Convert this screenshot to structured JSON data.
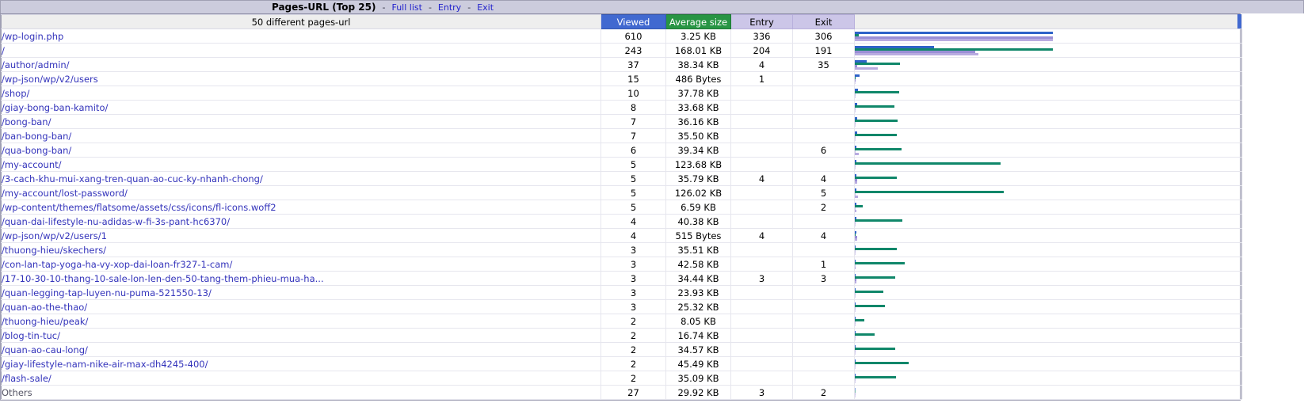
{
  "header": {
    "title": "Pages-URL (Top 25)",
    "separator": "-",
    "links": [
      {
        "label": "Full list"
      },
      {
        "label": "Entry"
      },
      {
        "label": "Exit"
      }
    ]
  },
  "table": {
    "summary_label": "50 different pages-url",
    "columns": {
      "url": "",
      "viewed": "Viewed",
      "average_size": "Average size",
      "entry": "Entry",
      "exit": "Exit"
    },
    "colors": {
      "viewed": "#4169d0",
      "average_size": "#289544",
      "entry": "#ccc6e8",
      "exit": "#ccc6e8",
      "bar_viewed": "#2e63c8",
      "bar_size": "#10876a",
      "bar_entry": "#9a8fd6",
      "bar_exit": "#b8abe0"
    },
    "rows": [
      {
        "url": "/wp-login.php",
        "viewed": "610",
        "average_size": "3.25 KB",
        "entry": "336",
        "exit": "306"
      },
      {
        "url": "/",
        "viewed": "243",
        "average_size": "168.01 KB",
        "entry": "204",
        "exit": "191"
      },
      {
        "url": "/author/admin/",
        "viewed": "37",
        "average_size": "38.34 KB",
        "entry": "4",
        "exit": "35"
      },
      {
        "url": "/wp-json/wp/v2/users",
        "viewed": "15",
        "average_size": "486 Bytes",
        "entry": "1",
        "exit": ""
      },
      {
        "url": "/shop/",
        "viewed": "10",
        "average_size": "37.78 KB",
        "entry": "",
        "exit": ""
      },
      {
        "url": "/giay-bong-ban-kamito/",
        "viewed": "8",
        "average_size": "33.68 KB",
        "entry": "",
        "exit": ""
      },
      {
        "url": "/bong-ban/",
        "viewed": "7",
        "average_size": "36.16 KB",
        "entry": "",
        "exit": ""
      },
      {
        "url": "/ban-bong-ban/",
        "viewed": "7",
        "average_size": "35.50 KB",
        "entry": "",
        "exit": ""
      },
      {
        "url": "/qua-bong-ban/",
        "viewed": "6",
        "average_size": "39.34 KB",
        "entry": "",
        "exit": "6"
      },
      {
        "url": "/my-account/",
        "viewed": "5",
        "average_size": "123.68 KB",
        "entry": "",
        "exit": ""
      },
      {
        "url": "/3-cach-khu-mui-xang-tren-quan-ao-cuc-ky-nhanh-chong/",
        "viewed": "5",
        "average_size": "35.79 KB",
        "entry": "4",
        "exit": "4"
      },
      {
        "url": "/my-account/lost-password/",
        "viewed": "5",
        "average_size": "126.02 KB",
        "entry": "",
        "exit": "5"
      },
      {
        "url": "/wp-content/themes/flatsome/assets/css/icons/fl-icons.woff2",
        "viewed": "5",
        "average_size": "6.59 KB",
        "entry": "",
        "exit": "2"
      },
      {
        "url": "/quan-dai-lifestyle-nu-adidas-w-fi-3s-pant-hc6370/",
        "viewed": "4",
        "average_size": "40.38 KB",
        "entry": "",
        "exit": ""
      },
      {
        "url": "/wp-json/wp/v2/users/1",
        "viewed": "4",
        "average_size": "515 Bytes",
        "entry": "4",
        "exit": "4"
      },
      {
        "url": "/thuong-hieu/skechers/",
        "viewed": "3",
        "average_size": "35.51 KB",
        "entry": "",
        "exit": ""
      },
      {
        "url": "/con-lan-tap-yoga-ha-vy-xop-dai-loan-fr327-1-cam/",
        "viewed": "3",
        "average_size": "42.58 KB",
        "entry": "",
        "exit": "1"
      },
      {
        "url": "/17-10-30-10-thang-10-sale-lon-len-den-50-tang-them-phieu-mua-ha...",
        "viewed": "3",
        "average_size": "34.44 KB",
        "entry": "3",
        "exit": "3"
      },
      {
        "url": "/quan-legging-tap-luyen-nu-puma-521550-13/",
        "viewed": "3",
        "average_size": "23.93 KB",
        "entry": "",
        "exit": ""
      },
      {
        "url": "/quan-ao-the-thao/",
        "viewed": "3",
        "average_size": "25.32 KB",
        "entry": "",
        "exit": ""
      },
      {
        "url": "/thuong-hieu/peak/",
        "viewed": "2",
        "average_size": "8.05 KB",
        "entry": "",
        "exit": ""
      },
      {
        "url": "/blog-tin-tuc/",
        "viewed": "2",
        "average_size": "16.74 KB",
        "entry": "",
        "exit": ""
      },
      {
        "url": "/quan-ao-cau-long/",
        "viewed": "2",
        "average_size": "34.57 KB",
        "entry": "",
        "exit": ""
      },
      {
        "url": "/giay-lifestyle-nam-nike-air-max-dh4245-400/",
        "viewed": "2",
        "average_size": "45.49 KB",
        "entry": "",
        "exit": ""
      },
      {
        "url": "/flash-sale/",
        "viewed": "2",
        "average_size": "35.09 KB",
        "entry": "",
        "exit": ""
      },
      {
        "url": "Others",
        "viewed": "27",
        "average_size": "29.92 KB",
        "entry": "3",
        "exit": "2"
      }
    ]
  },
  "chart_data": {
    "type": "bar",
    "title": "Pages-URL (Top 25)",
    "orientation": "horizontal",
    "grid": false,
    "legend": [
      "Viewed",
      "Average size",
      "Entry",
      "Exit"
    ],
    "legend_position": "column-headers",
    "categories": [
      "/wp-login.php",
      "/",
      "/author/admin/",
      "/wp-json/wp/v2/users",
      "/shop/",
      "/giay-bong-ban-kamito/",
      "/bong-ban/",
      "/ban-bong-ban/",
      "/qua-bong-ban/",
      "/my-account/",
      "/3-cach-khu-mui-xang-tren-quan-ao-cuc-ky-nhanh-chong/",
      "/my-account/lost-password/",
      "/wp-content/themes/flatsome/assets/css/icons/fl-icons.woff2",
      "/quan-dai-lifestyle-nu-adidas-w-fi-3s-pant-hc6370/",
      "/wp-json/wp/v2/users/1",
      "/thuong-hieu/skechers/",
      "/con-lan-tap-yoga-ha-vy-xop-dai-loan-fr327-1-cam/",
      "/17-10-30-10-thang-10-sale-lon-len-den-50-tang-them-phieu-mua-ha...",
      "/quan-legging-tap-luyen-nu-puma-521550-13/",
      "/quan-ao-the-thao/",
      "/thuong-hieu/peak/",
      "/blog-tin-tuc/",
      "/quan-ao-cau-long/",
      "/giay-lifestyle-nam-nike-air-max-dh4245-400/",
      "/flash-sale/",
      "Others"
    ],
    "series": [
      {
        "name": "Viewed",
        "color": "#2e63c8",
        "max": 610,
        "values": [
          610,
          243,
          37,
          15,
          10,
          8,
          7,
          7,
          6,
          5,
          5,
          5,
          5,
          4,
          4,
          3,
          3,
          3,
          3,
          3,
          2,
          2,
          2,
          2,
          2,
          0
        ]
      },
      {
        "name": "Average size",
        "color": "#10876a",
        "unit": "KB",
        "max": 168.01,
        "values": [
          3.25,
          168.01,
          38.34,
          0.474,
          37.78,
          33.68,
          36.16,
          35.5,
          39.34,
          123.68,
          35.79,
          126.02,
          6.59,
          40.38,
          0.503,
          35.51,
          42.58,
          34.44,
          23.93,
          25.32,
          8.05,
          16.74,
          34.57,
          45.49,
          35.09,
          0
        ]
      },
      {
        "name": "Entry",
        "color": "#9a8fd6",
        "max": 336,
        "values": [
          336,
          204,
          4,
          1,
          0,
          0,
          0,
          0,
          0,
          0,
          4,
          0,
          0,
          0,
          4,
          0,
          0,
          3,
          0,
          0,
          0,
          0,
          0,
          0,
          0,
          0
        ]
      },
      {
        "name": "Exit",
        "color": "#b8abe0",
        "max": 306,
        "values": [
          306,
          191,
          35,
          0,
          0,
          0,
          0,
          0,
          6,
          0,
          4,
          5,
          2,
          0,
          4,
          0,
          1,
          3,
          0,
          0,
          0,
          0,
          0,
          0,
          0,
          0
        ]
      }
    ],
    "xlabel": "",
    "ylabel": ""
  }
}
